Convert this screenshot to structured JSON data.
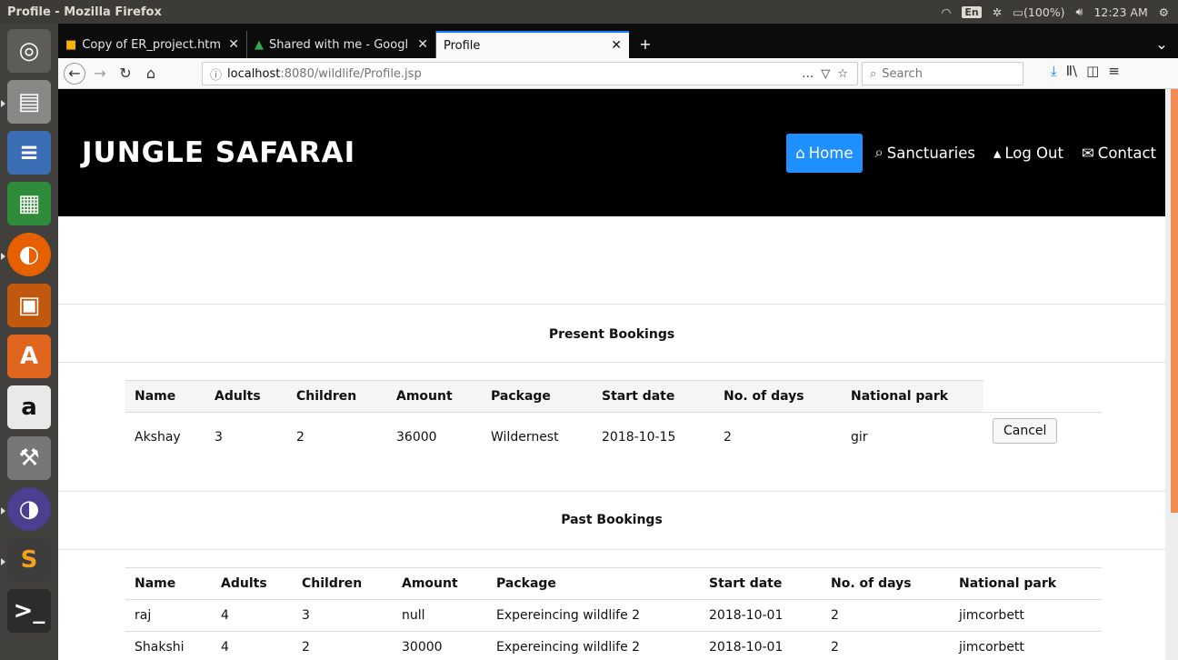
{
  "os": {
    "window_title": "Profile - Mozilla Firefox",
    "lang": "En",
    "battery": "(100%)",
    "time": "12:23 AM"
  },
  "tabs": [
    {
      "label": "Copy of ER_project.htm"
    },
    {
      "label": "Shared with me - Googl"
    },
    {
      "label": "Profile"
    }
  ],
  "url": {
    "host": "localhost",
    "path": ":8080/wildlife/Profile.jsp"
  },
  "search": {
    "placeholder": "Search"
  },
  "site": {
    "brand": "JUNGLE SAFARAI",
    "nav": [
      {
        "label": "Home",
        "icon": "home-icon"
      },
      {
        "label": "Sanctuaries",
        "icon": "search-icon"
      },
      {
        "label": "Log Out",
        "icon": "user-icon"
      },
      {
        "label": "Contact",
        "icon": "envelope-icon"
      }
    ]
  },
  "present": {
    "title": "Present Bookings",
    "headers": [
      "Name",
      "Adults",
      "Children",
      "Amount",
      "Package",
      "Start date",
      "No. of days",
      "National park"
    ],
    "rows": [
      [
        "Akshay",
        "3",
        "2",
        "36000",
        "Wildernest",
        "2018-10-15",
        "2",
        "gir"
      ]
    ],
    "cancel_label": "Cancel"
  },
  "past": {
    "title": "Past Bookings",
    "headers": [
      "Name",
      "Adults",
      "Children",
      "Amount",
      "Package",
      "Start date",
      "No. of days",
      "National park"
    ],
    "rows": [
      [
        "raj",
        "4",
        "3",
        "null",
        "Expereincing wildlife 2",
        "2018-10-01",
        "2",
        "jimcorbett"
      ],
      [
        "Shakshi",
        "4",
        "2",
        "30000",
        "Expereincing wildlife 2",
        "2018-10-01",
        "2",
        "jimcorbett"
      ]
    ]
  }
}
